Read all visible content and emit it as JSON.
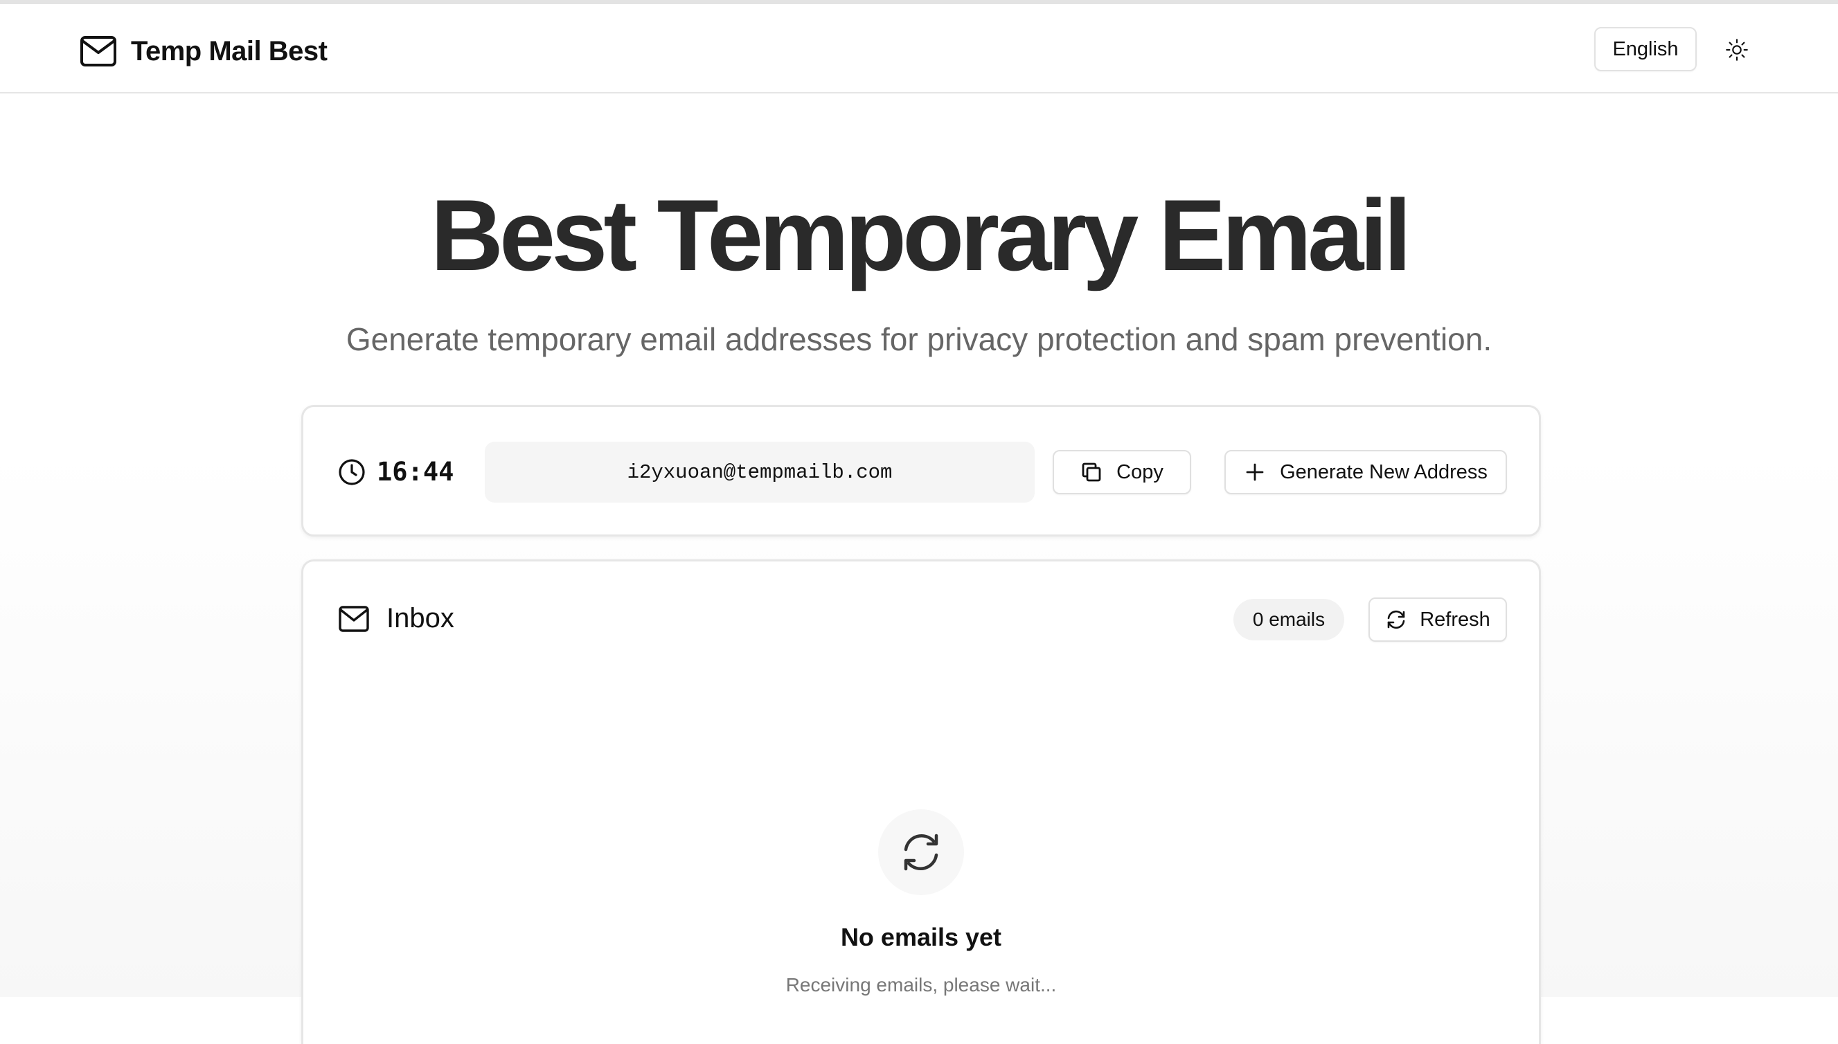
{
  "header": {
    "brand_name": "Temp Mail Best",
    "language_label": "English"
  },
  "hero": {
    "title": "Best Temporary Email",
    "subtitle": "Generate temporary email addresses for privacy protection and spam prevention."
  },
  "address_card": {
    "timer": "16:44",
    "email": "i2yxuoan@tempmailb.com",
    "copy_label": "Copy",
    "generate_label": "Generate New Address"
  },
  "inbox": {
    "title": "Inbox",
    "count_label": "0 emails",
    "refresh_label": "Refresh",
    "empty_title": "No emails yet",
    "empty_subtitle": "Receiving emails, please wait..."
  },
  "icons": {
    "brand": "mail-icon",
    "theme": "sun-icon",
    "timer": "clock-icon",
    "copy": "copy-icon",
    "generate": "plus-icon",
    "inbox": "mail-icon",
    "refresh": "refresh-icon",
    "empty": "refresh-icon"
  },
  "colors": {
    "text": "#111111",
    "muted": "#666666",
    "border": "#e6e6e6",
    "field_bg": "#f5f5f5"
  }
}
